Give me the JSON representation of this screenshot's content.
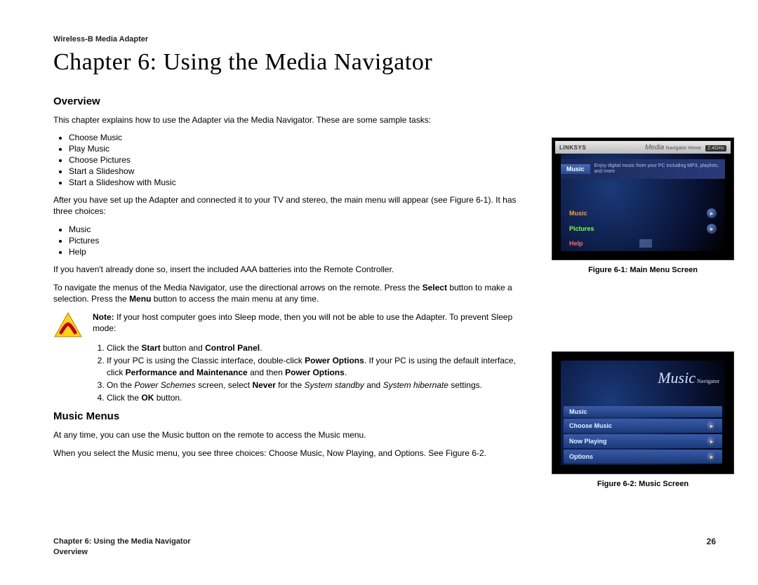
{
  "header": {
    "product": "Wireless-B Media Adapter"
  },
  "chapter": {
    "title": "Chapter 6: Using the Media Navigator"
  },
  "overview": {
    "heading": "Overview",
    "intro": "This chapter explains how to use the Adapter via the Media Navigator. These are some sample tasks:",
    "tasks": [
      "Choose Music",
      "Play Music",
      "Choose Pictures",
      "Start a Slideshow",
      "Start a Slideshow with Music"
    ],
    "after_setup": "After you have set up the Adapter and connected it to your TV and stereo, the main menu will appear (see Figure 6-1). It has three choices:",
    "choices": [
      "Music",
      "Pictures",
      "Help"
    ],
    "batteries": "If you haven't already done so, insert the included AAA batteries into the Remote Controller.",
    "navigate_pre": "To navigate the menus of the Media Navigator, use the directional arrows on the remote. Press the ",
    "select_bold": "Select",
    "navigate_mid": " button to make a selection. Press the ",
    "menu_bold": "Menu",
    "navigate_post": " button to access the main menu at any time."
  },
  "note": {
    "label": "Note:",
    "body": " If your host computer goes into Sleep mode, then you will not be able to use the Adapter. To prevent Sleep mode:",
    "step1_a": "Click the ",
    "step1_b": "Start",
    "step1_c": " button and ",
    "step1_d": "Control Panel",
    "step1_e": ".",
    "step2_a": "If your PC is using the Classic interface, double-click ",
    "step2_b": "Power Options",
    "step2_c": ". If your PC is using the default interface, click ",
    "step2_d": "Performance and Maintenance",
    "step2_e": " and then ",
    "step2_f": "Power Options",
    "step2_g": ".",
    "step3_a": "On the ",
    "step3_b": "Power Schemes",
    "step3_c": " screen, select ",
    "step3_d": "Never",
    "step3_e": " for the ",
    "step3_f": "System standby",
    "step3_g": " and ",
    "step3_h": "System hibernate",
    "step3_i": " settings.",
    "step4_a": "Click the ",
    "step4_b": "OK",
    "step4_c": " button."
  },
  "music": {
    "heading": "Music Menus",
    "p1": "At any time, you can use the Music button on the remote to access the Music menu.",
    "p2": "When you select the Music menu, you see three choices: Choose Music, Now Playing, and Options. See Figure 6-2."
  },
  "figures": {
    "f1": {
      "caption": "Figure 6-1: Main Menu Screen",
      "brand": "LINKSYS",
      "title_right": "Media",
      "title_sub": "Navigator Home",
      "ghz": "2.4GHz",
      "banner_tag": "Music",
      "banner_desc": "Enjoy digital music from your PC including MP3, playlists, and more",
      "rows": [
        "Music",
        "Pictures",
        "Help"
      ]
    },
    "f2": {
      "caption": "Figure 6-2: Music Screen",
      "heading": "Music",
      "heading_sub": "Navigator",
      "rows": [
        "Music",
        "Choose Music",
        "Now Playing",
        "Options"
      ]
    }
  },
  "footer": {
    "chapter": "Chapter 6: Using the Media Navigator",
    "section": "Overview",
    "page": "26"
  }
}
